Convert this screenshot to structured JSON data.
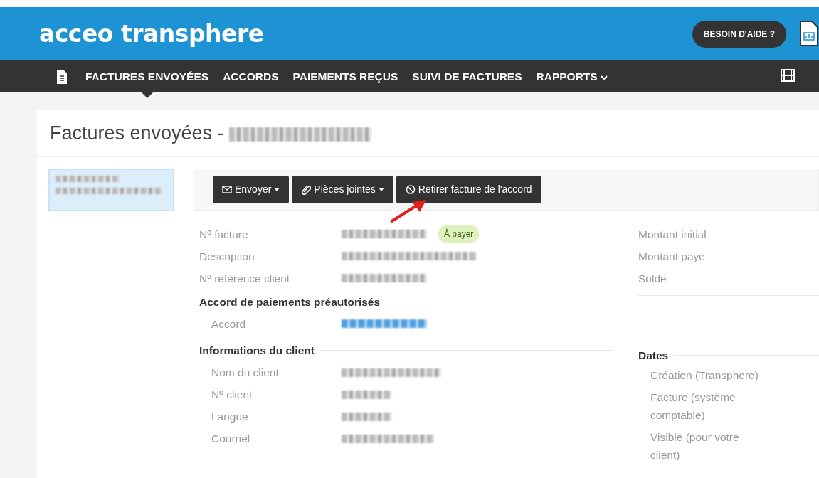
{
  "header": {
    "logo": "acceo transphere",
    "help_button": "BESOIN D'AIDE ?"
  },
  "nav": {
    "items": [
      {
        "label": "FACTURES ENVOYÉES",
        "selected": true,
        "dropdown": false
      },
      {
        "label": "ACCORDS",
        "selected": false,
        "dropdown": false
      },
      {
        "label": "PAIEMENTS REÇUS",
        "selected": false,
        "dropdown": false
      },
      {
        "label": "SUIVI DE FACTURES",
        "selected": false,
        "dropdown": false
      },
      {
        "label": "RAPPORTS",
        "selected": false,
        "dropdown": true
      }
    ]
  },
  "page": {
    "title": "Factures envoyées -",
    "title_redacted": true
  },
  "sidebar": {
    "items": [
      {
        "redacted": true,
        "selected": true
      }
    ]
  },
  "toolbar": {
    "buttons": [
      {
        "kind": "mail",
        "label": "Envoyer",
        "dropdown": true
      },
      {
        "kind": "clip",
        "label": "Pièces jointes",
        "dropdown": true
      },
      {
        "kind": "ban",
        "label": "Retirer facture de l'accord",
        "dropdown": false
      }
    ]
  },
  "invoice": {
    "fields": [
      {
        "label": "Nº facture",
        "redacted": true,
        "badge": "À payer"
      },
      {
        "label": "Description",
        "redacted": true
      },
      {
        "label": "Nº référence client",
        "redacted": true
      }
    ],
    "amounts": [
      "Montant initial",
      "Montant payé",
      "Solde"
    ]
  },
  "sections": [
    {
      "title": "Accord de paiements préautorisés",
      "fields": [
        {
          "label": "Accord",
          "redacted": true,
          "link": true
        }
      ]
    },
    {
      "title": "Informations du client",
      "fields": [
        {
          "label": "Nom du client",
          "redacted": true,
          "link": false
        },
        {
          "label": "Nº client",
          "redacted": true,
          "link": false
        },
        {
          "label": "Langue",
          "redacted": true,
          "link": false
        },
        {
          "label": "Courriel",
          "redacted": true,
          "link": false
        }
      ]
    }
  ],
  "dates": {
    "title": "Dates",
    "labels": [
      "Création (Transphere)",
      "Facture (système comptable)",
      "Visible (pour votre client)"
    ]
  },
  "annotation": {
    "arrow": true
  }
}
